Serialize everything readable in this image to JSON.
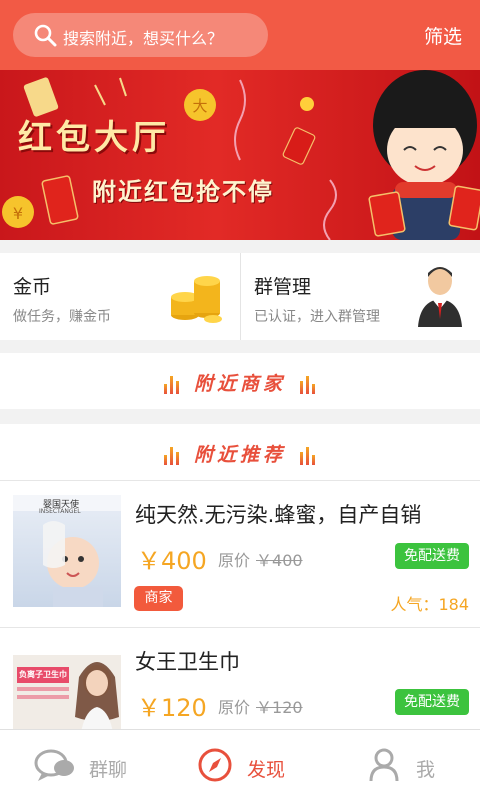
{
  "search": {
    "placeholder": "搜索附近，想买什么？"
  },
  "header": {
    "filter_label": "筛选"
  },
  "banner": {
    "title": "红包大厅",
    "subtitle": "附近红包抢不停"
  },
  "cards": [
    {
      "title": "金币",
      "subtitle": "做任务，赚金币",
      "icon": "gold-coins-icon"
    },
    {
      "title": "群管理",
      "subtitle": "已认证，进入群管理",
      "icon": "manager-avatar-icon"
    }
  ],
  "sections": {
    "nearby_merchants": "附近商家",
    "nearby_recommend": "附近推荐"
  },
  "products": [
    {
      "name": "纯天然.无污染.蜂蜜，自产自销",
      "price": "￥400",
      "orig_label": "原价",
      "orig_price": "￥400",
      "free_shipping": "免配送费",
      "tag": "商家",
      "popularity": "人气：184",
      "image_text": {
        "brand": "婴国天使",
        "brand_en": "INSECTANGEL"
      }
    },
    {
      "name": "女王卫生巾",
      "price": "￥120",
      "orig_label": "原价",
      "orig_price": "￥120",
      "free_shipping": "免配送费",
      "image_text": {
        "headline": "负离子卫生巾"
      }
    }
  ],
  "tabbar": [
    {
      "label": "群聊",
      "icon": "chat-bubbles-icon",
      "active": false
    },
    {
      "label": "发现",
      "icon": "compass-icon",
      "active": true
    },
    {
      "label": "我",
      "icon": "user-icon",
      "active": false
    }
  ],
  "colors": {
    "accent": "#f25a45",
    "price": "#f5a623",
    "free_shipping": "#3cc33e",
    "active_tab": "#e8503c",
    "inactive_tab": "#aaaaaa"
  }
}
